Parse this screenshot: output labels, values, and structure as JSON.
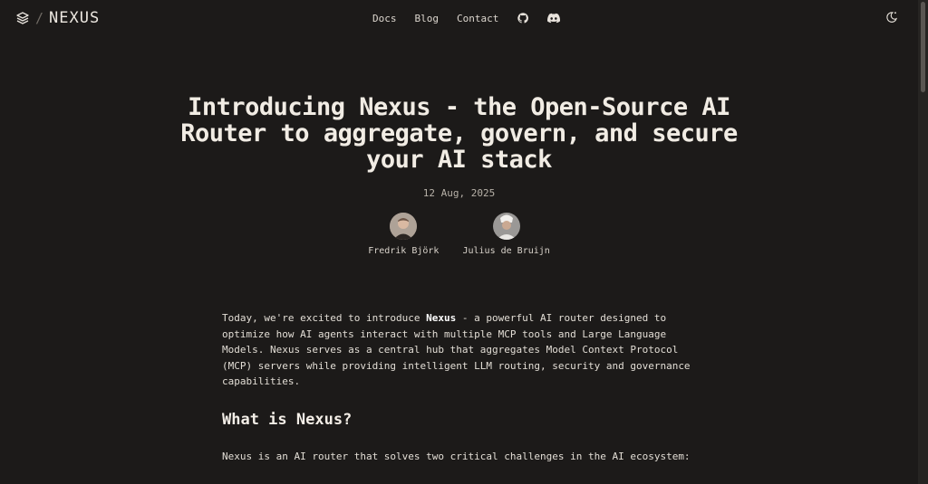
{
  "brand": {
    "name": "NEXUS",
    "separator": "/"
  },
  "nav": {
    "docs": "Docs",
    "blog": "Blog",
    "contact": "Contact"
  },
  "icons": {
    "logo": "layers-icon",
    "github": "github-icon",
    "discord": "discord-icon",
    "theme": "moon-sun-icon"
  },
  "post": {
    "title": "Introducing Nexus - the Open-Source AI Router to aggregate, govern, and secure your AI stack",
    "date": "12 Aug, 2025",
    "authors": [
      {
        "name": "Fredrik Björk"
      },
      {
        "name": "Julius de Bruijn"
      }
    ]
  },
  "body": {
    "intro_before": "Today, we're excited to introduce ",
    "intro_bold": "Nexus",
    "intro_after": " - a powerful AI router designed to optimize how AI agents interact with multiple MCP tools and Large Language Models. Nexus serves as a central hub that aggregates Model Context Protocol (MCP) servers while providing intelligent LLM routing, security and governance capabilities.",
    "heading": "What is Nexus?",
    "paragraph2": "Nexus is an AI router that solves two critical challenges in the AI ecosystem:"
  },
  "colors": {
    "background": "#1c1a19",
    "text": "#e8e3dc",
    "muted": "#b7b1a8"
  }
}
